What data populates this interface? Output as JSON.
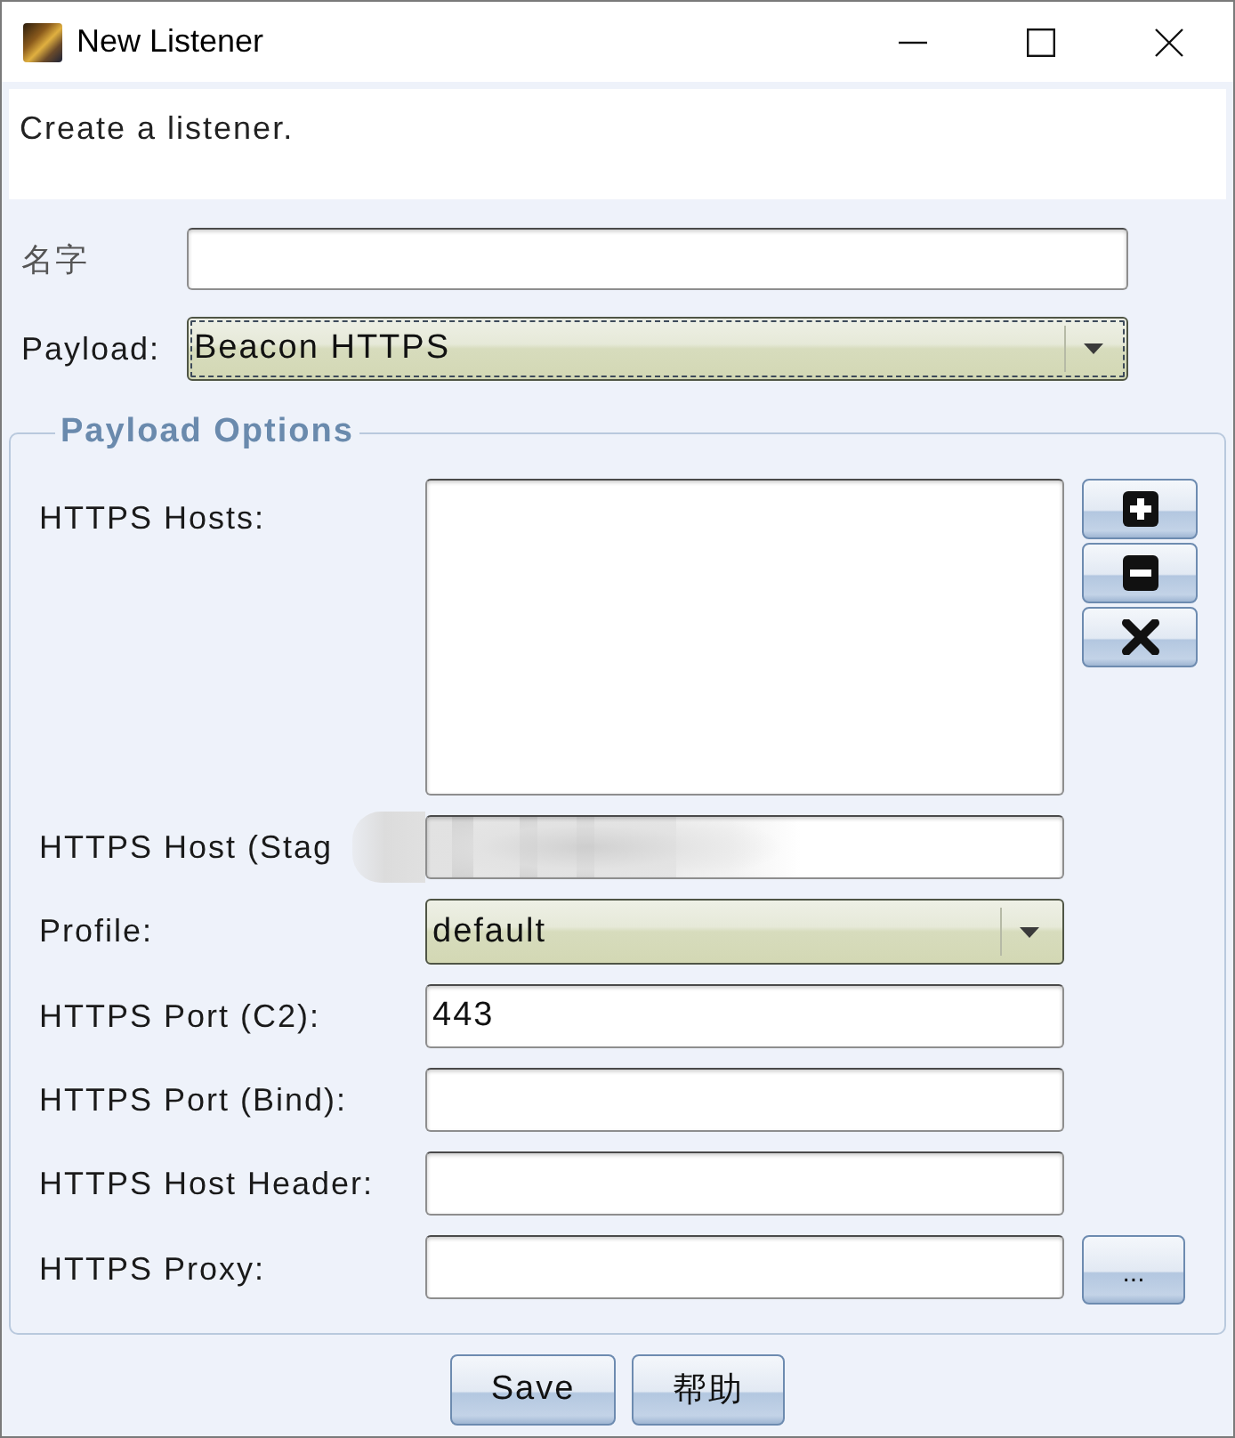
{
  "window": {
    "title": "New Listener"
  },
  "description": "Create a listener.",
  "fields": [
    {
      "kind": "text",
      "label": "名字"
    },
    {
      "kind": "select",
      "label": "Payload:",
      "value": "Beacon HTTPS",
      "focused": true
    }
  ],
  "payload_options": {
    "title": "Payload Options",
    "rows": [
      {
        "kind": "list",
        "label": "HTTPS Hosts:"
      },
      {
        "kind": "text",
        "label": "HTTPS Host (Stag",
        "redacted": true
      },
      {
        "kind": "select",
        "label": "Profile:",
        "value": "default",
        "focused": false
      },
      {
        "kind": "text",
        "label": "HTTPS Port (C2):",
        "value": "443"
      },
      {
        "kind": "text",
        "label": "HTTPS Port (Bind):"
      },
      {
        "kind": "text",
        "label": "HTTPS Host Header:"
      },
      {
        "kind": "text",
        "label": "HTTPS Proxy:",
        "button": "..."
      }
    ]
  },
  "buttons": [
    "Save",
    "帮助"
  ]
}
